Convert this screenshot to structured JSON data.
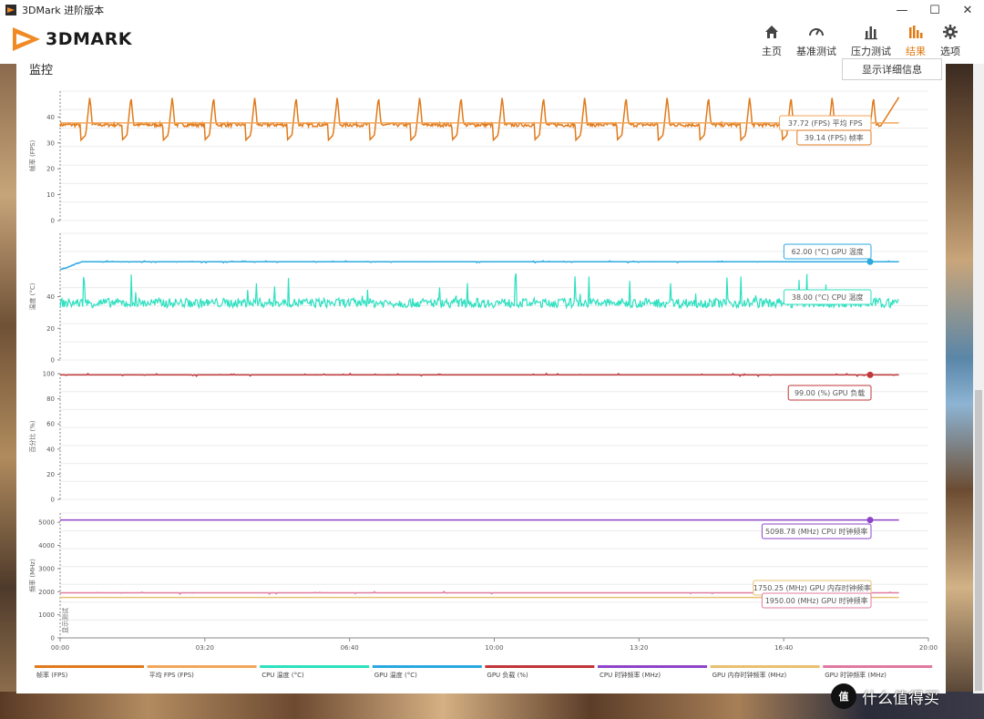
{
  "window": {
    "title": "3DMark 进阶版本",
    "minimize": "—",
    "maximize": "☐",
    "close": "✕"
  },
  "app": {
    "logo_text": "3DMARK"
  },
  "nav": [
    {
      "label": "主页",
      "icon": "home-icon"
    },
    {
      "label": "基准测试",
      "icon": "gauge-icon"
    },
    {
      "label": "压力测试",
      "icon": "bar-chart-icon"
    },
    {
      "label": "结果",
      "icon": "results-icon",
      "active": true
    },
    {
      "label": "选项",
      "icon": "gear-icon"
    }
  ],
  "accent_color": "#e07a12",
  "monitor": {
    "title": "监控",
    "details_button": "显示详细信息"
  },
  "watermark": {
    "logo": "值",
    "text": "什么值得买"
  },
  "chart_data": {
    "type": "line",
    "x_ticks": [
      "00:00",
      "03:20",
      "06:40",
      "10:00",
      "13:20",
      "16:40",
      "20:00"
    ],
    "xlim_seconds": [
      0,
      1200
    ],
    "data_end_seconds": 1160,
    "marker_label": "显示测试",
    "panels": [
      {
        "ylabel": "帧率 (FPS)",
        "yticks": [
          0,
          10,
          20,
          30,
          40
        ],
        "ylim": [
          0,
          50
        ],
        "series": [
          {
            "name": "帧率 (FPS)",
            "color": "#e07a1c",
            "style": "sawtooth",
            "base": 37,
            "low": 31,
            "high": 48,
            "period_s": 57,
            "end_value": 48
          },
          {
            "name": "平均 FPS (FPS)",
            "color": "#f2a65a",
            "style": "flat",
            "value": 37.72
          }
        ],
        "callouts": [
          {
            "text": "37.72 (FPS) 平均 FPS",
            "color": "#f2a65a"
          },
          {
            "text": "39.14 (FPS) 帧率",
            "color": "#e07a1c"
          }
        ]
      },
      {
        "ylabel": "温度 (°C)",
        "yticks": [
          0,
          20,
          40
        ],
        "ylim": [
          0,
          80
        ],
        "series": [
          {
            "name": "GPU 温度 (°C)",
            "color": "#2aa8e0",
            "style": "rise_then_flat",
            "start": 57,
            "value": 62
          },
          {
            "name": "CPU 温度 (°C)",
            "color": "#2de0c0",
            "style": "noisy",
            "base": 36,
            "spread": 6,
            "spike_max": 55,
            "end_value": 38
          }
        ],
        "callouts": [
          {
            "text": "62.00 (°C) GPU 温度",
            "color": "#2aa8e0"
          },
          {
            "text": "38.00 (°C) CPU 温度",
            "color": "#2de0c0"
          }
        ]
      },
      {
        "ylabel": "百分比 (%)",
        "yticks": [
          0,
          20,
          40,
          60,
          80,
          100
        ],
        "ylim": [
          0,
          100
        ],
        "series": [
          {
            "name": "GPU 负载 (%)",
            "color": "#c0363a",
            "style": "flat_jitter",
            "value": 99
          }
        ],
        "callouts": [
          {
            "text": "99.00 (%) GPU 负载",
            "color": "#c0363a"
          }
        ]
      },
      {
        "ylabel": "频率 (MHz)",
        "yticks": [
          0,
          1000,
          2000,
          3000,
          4000,
          5000
        ],
        "ylim": [
          0,
          5400
        ],
        "series": [
          {
            "name": "CPU 时钟频率 (MHz)",
            "color": "#8e44c8",
            "style": "flat",
            "value": 5098.78
          },
          {
            "name": "GPU 内存时钟频率 (MHz)",
            "color": "#e8c070",
            "style": "flat",
            "value": 1750.25
          },
          {
            "name": "GPU 时钟频率 (MHz)",
            "color": "#e07aa0",
            "style": "flat_jitter",
            "value": 1950
          }
        ],
        "callouts": [
          {
            "text": "5098.78 (MHz) CPU 时钟频率",
            "color": "#8e44c8"
          },
          {
            "text": "1750.25 (MHz) GPU 内存时钟频率",
            "color": "#e8c070"
          },
          {
            "text": "1950.00 (MHz) GPU 时钟频率",
            "color": "#e07aa0"
          }
        ]
      }
    ],
    "legend": [
      {
        "name": "帧率 (FPS)",
        "color": "#e07a1c"
      },
      {
        "name": "平均 FPS (FPS)",
        "color": "#f2a65a"
      },
      {
        "name": "CPU 温度 (°C)",
        "color": "#2de0c0"
      },
      {
        "name": "GPU 温度 (°C)",
        "color": "#2aa8e0"
      },
      {
        "name": "GPU 负载 (%)",
        "color": "#c0363a"
      },
      {
        "name": "CPU 时钟频率 (MHz)",
        "color": "#8e44c8"
      },
      {
        "name": "GPU 内存时钟频率 (MHz)",
        "color": "#e8c070"
      },
      {
        "name": "GPU 时钟频率 (MHz)",
        "color": "#e07aa0"
      }
    ]
  }
}
